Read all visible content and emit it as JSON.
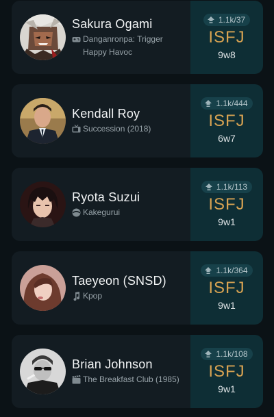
{
  "profiles": [
    {
      "name": "Sakura Ogami",
      "category_icon": "game-controller-icon",
      "source": "Danganronpa: Trigger Happy Havoc",
      "votes": "1.1k/37",
      "type": "ISFJ",
      "enneagram": "9w8"
    },
    {
      "name": "Kendall Roy",
      "category_icon": "tv-icon",
      "source": "Succession (2018)",
      "votes": "1.1k/444",
      "type": "ISFJ",
      "enneagram": "6w7"
    },
    {
      "name": "Ryota Suzui",
      "category_icon": "anime-icon",
      "source": "Kakegurui",
      "votes": "1.1k/113",
      "type": "ISFJ",
      "enneagram": "9w1"
    },
    {
      "name": "Taeyeon (SNSD)",
      "category_icon": "music-icon",
      "source": "Kpop",
      "votes": "1.1k/364",
      "type": "ISFJ",
      "enneagram": "9w1"
    },
    {
      "name": "Brian Johnson",
      "category_icon": "movie-icon",
      "source": "The Breakfast Club (1985)",
      "votes": "1.1k/108",
      "type": "ISFJ",
      "enneagram": "9w1"
    }
  ],
  "colors": {
    "background": "#0b1216",
    "card": "#131c22",
    "type_panel": "#0e2e35",
    "type_text": "#d8a352"
  }
}
